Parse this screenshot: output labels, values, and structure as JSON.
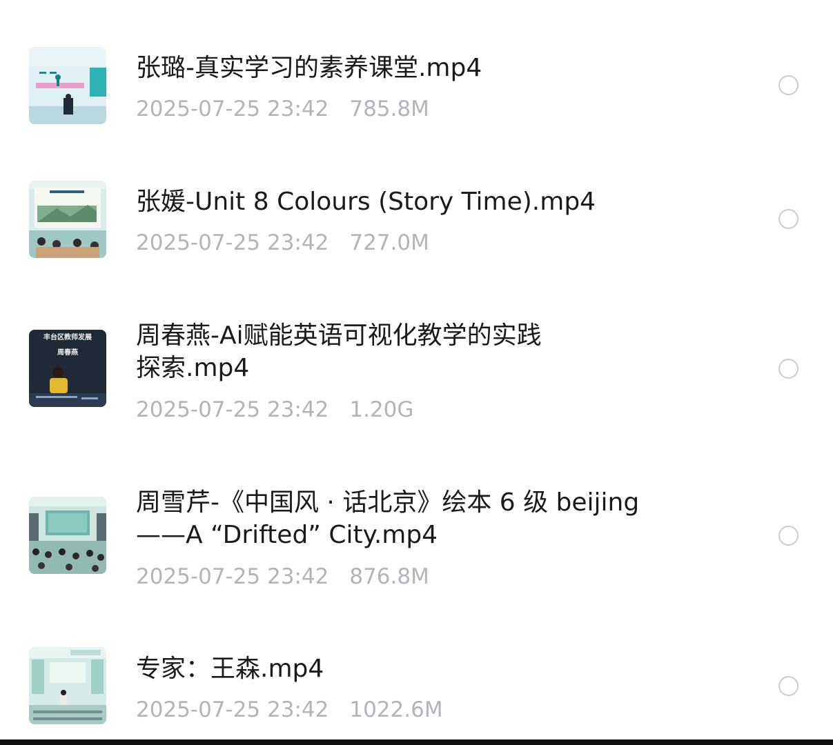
{
  "files": [
    {
      "name": "张璐-真实学习的素养课堂.mp4",
      "date": "2025-07-25 23:42",
      "size": "785.8M",
      "thumbnail": "video-thumbnail-classroom-stage-teal",
      "checked": false
    },
    {
      "name": "张媛-Unit 8 Colours (Story Time).mp4",
      "date": "2025-07-25 23:42",
      "size": "727.0M",
      "thumbnail": "video-thumbnail-classroom-landscape-screen",
      "checked": false
    },
    {
      "name_line1": "周春燕-Ai赋能英语可视化教学的实践",
      "name_line2": "探索.mp4",
      "date": "2025-07-25 23:42",
      "size": "1.20G",
      "thumbnail": "video-thumbnail-speaker-dark-banner",
      "thumbnail_text_top": "丰台区教师发展",
      "thumbnail_text_name": "周春燕",
      "checked": false
    },
    {
      "name_line1": "周雪芹-《中国风 · 话北京》绘本 6 级 beijing",
      "name_line2": "——A “Drifted” City.mp4",
      "date": "2025-07-25 23:42",
      "size": "876.8M",
      "thumbnail": "video-thumbnail-auditorium-audience",
      "checked": false
    },
    {
      "name": "专家：王森.mp4",
      "date": "2025-07-25 23:42",
      "size": "1022.6M",
      "thumbnail": "video-thumbnail-lecture-hall-podium",
      "checked": false
    }
  ],
  "colors": {
    "title": "#1a1a1a",
    "meta": "#b2b4bb",
    "radio_border": "#c9cbd0",
    "background": "#ffffff"
  }
}
